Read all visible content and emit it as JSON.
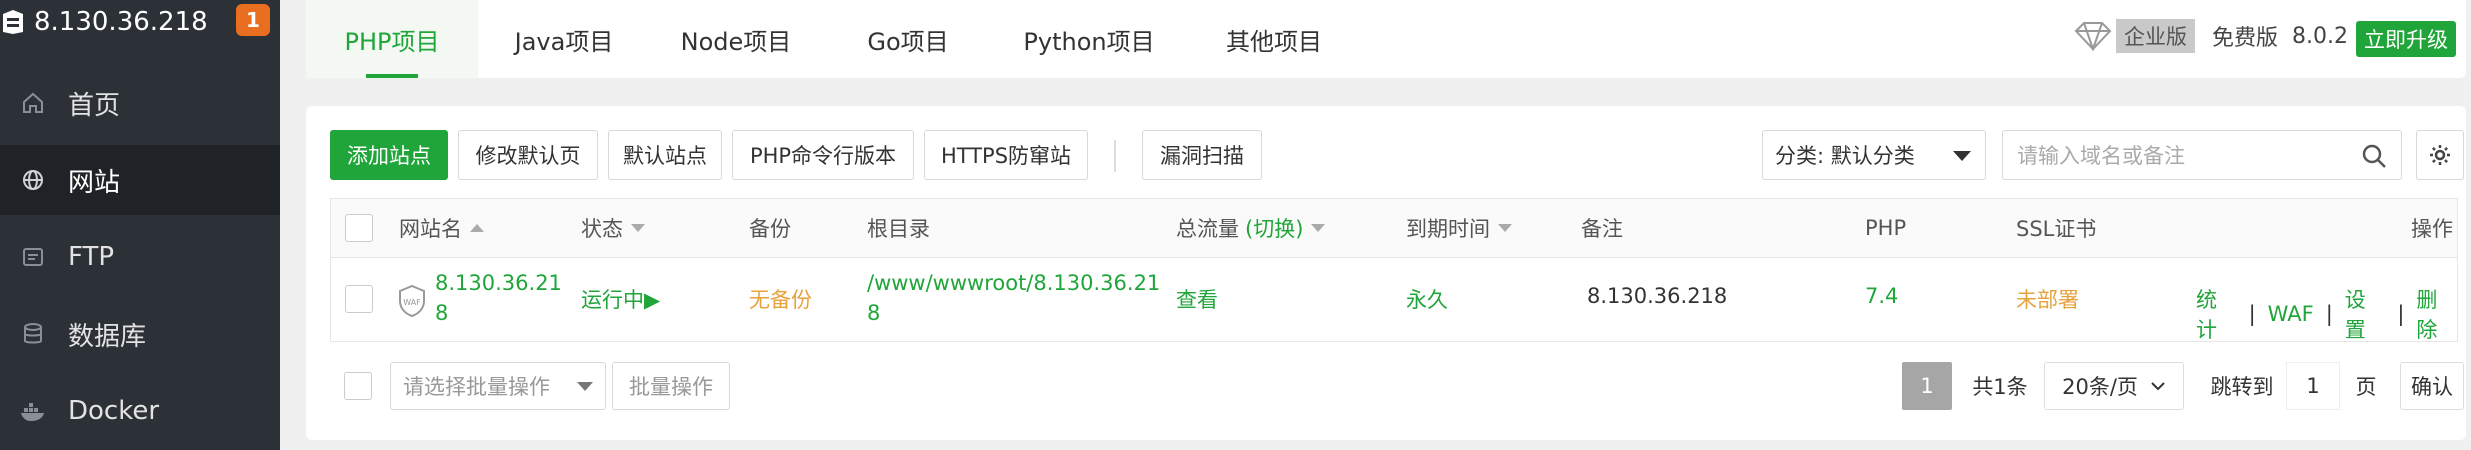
{
  "sidebar": {
    "host": "8.130.36.218",
    "badge": "1",
    "items": [
      {
        "label": "首页",
        "icon": "home-icon"
      },
      {
        "label": "网站",
        "icon": "globe-icon"
      },
      {
        "label": "FTP",
        "icon": "ftp-icon"
      },
      {
        "label": "数据库",
        "icon": "database-icon"
      },
      {
        "label": "Docker",
        "icon": "docker-icon"
      }
    ]
  },
  "tabs": [
    "PHP项目",
    "Java项目",
    "Node项目",
    "Go项目",
    "Python项目",
    "其他项目"
  ],
  "version": {
    "enterprise": "企业版",
    "free": "免费版",
    "number": "8.0.2",
    "upgrade": "立即升级"
  },
  "toolbar": {
    "add_site": "添加站点",
    "edit_default_page": "修改默认页",
    "default_site": "默认站点",
    "php_cli": "PHP命令行版本",
    "https_guard": "HTTPS防窜站",
    "vuln_scan": "漏洞扫描",
    "category": "分类: 默认分类",
    "search_placeholder": "请输入域名或备注"
  },
  "table": {
    "headers": {
      "name": "网站名",
      "status": "状态",
      "backup": "备份",
      "root": "根目录",
      "traffic": "总流量",
      "traffic_switch": "(切换)",
      "expire": "到期时间",
      "remark": "备注",
      "php": "PHP",
      "ssl": "SSL证书",
      "ops": "操作"
    },
    "rows": [
      {
        "name_line1": "8.130.36.21",
        "name_line2": "8",
        "status": "运行中▶",
        "backup": "无备份",
        "root_line1": "/www/wwwroot/8.130.36.21",
        "root_line2": "8",
        "traffic": "查看",
        "expire": "永久",
        "remark": "8.130.36.218",
        "php": "7.4",
        "ssl": "未部署",
        "ops": [
          "统计",
          "WAF",
          "设置",
          "删除"
        ]
      }
    ]
  },
  "footer": {
    "batch_placeholder": "请选择批量操作",
    "batch_button": "批量操作",
    "current_page": "1",
    "total": "共1条",
    "per_page": "20条/页",
    "goto_label": "跳转到",
    "goto_value": "1",
    "page_unit": "页",
    "confirm": "确认"
  },
  "colors": {
    "accent": "#20a53a",
    "sidebar_bg": "#2c3138",
    "warning": "#e6a23c",
    "badge": "#e96e1f"
  }
}
